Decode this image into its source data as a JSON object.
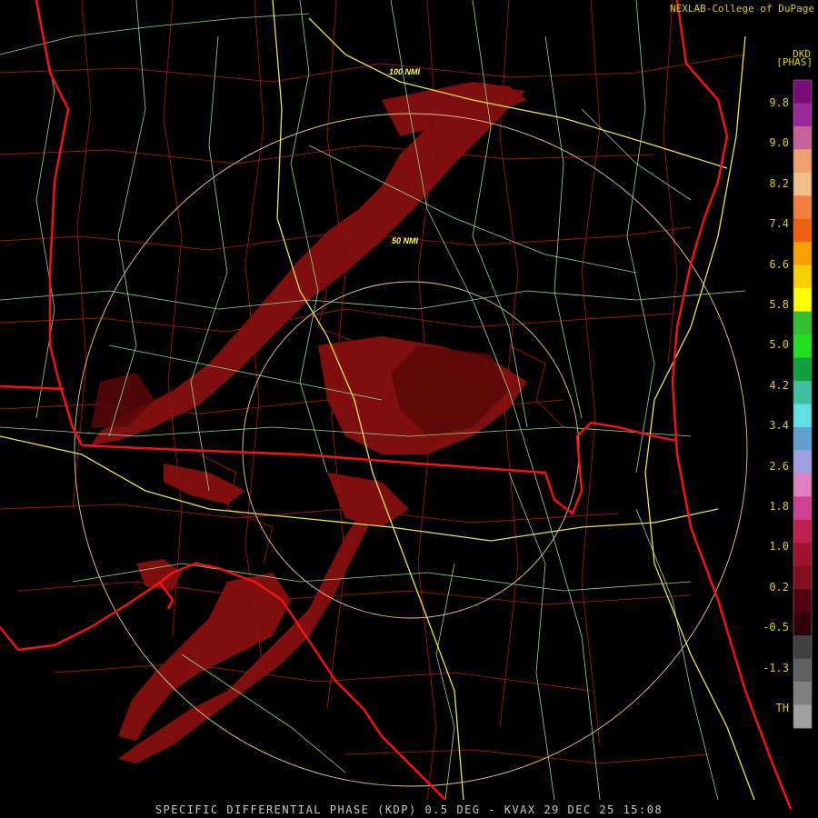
{
  "header": {
    "credit": "NEXLAB-College of DuPage",
    "product_code": "DKD",
    "units": "[PHAS]"
  },
  "range_rings": [
    "100 NMI",
    "50 NMI"
  ],
  "footer": {
    "caption": "SPECIFIC DIFFERENTIAL PHASE (KDP) 0.5 DEG - KVAX 29 DEC 25 15:08"
  },
  "color_scale": {
    "labels": [
      "9.8",
      "9.0",
      "8.2",
      "7.4",
      "6.6",
      "5.8",
      "5.0",
      "4.2",
      "3.4",
      "2.6",
      "1.8",
      "1.0",
      "0.2",
      "-0.5",
      "-1.3",
      "TH"
    ],
    "colors": [
      "#7a0c7a",
      "#9a2a9a",
      "#c8609a",
      "#f0a070",
      "#f0c08a",
      "#f08040",
      "#f06010",
      "#f8a000",
      "#f8d000",
      "#ffff00",
      "#30c030",
      "#20e020",
      "#10a040",
      "#40c0a0",
      "#60e0e0",
      "#60a0d0",
      "#a0a0e0",
      "#e080c0",
      "#d04090",
      "#c02050",
      "#a01030",
      "#801020",
      "#500010",
      "#300008",
      "#404040",
      "#606060",
      "#808080",
      "#a0a0a0"
    ]
  },
  "colors": {
    "state_border": "#ff1010",
    "county_border": "#b01010",
    "highway": "#e8e840",
    "road": "#90d890",
    "range_ring": "#e8c890",
    "echo": "#8a1010"
  }
}
